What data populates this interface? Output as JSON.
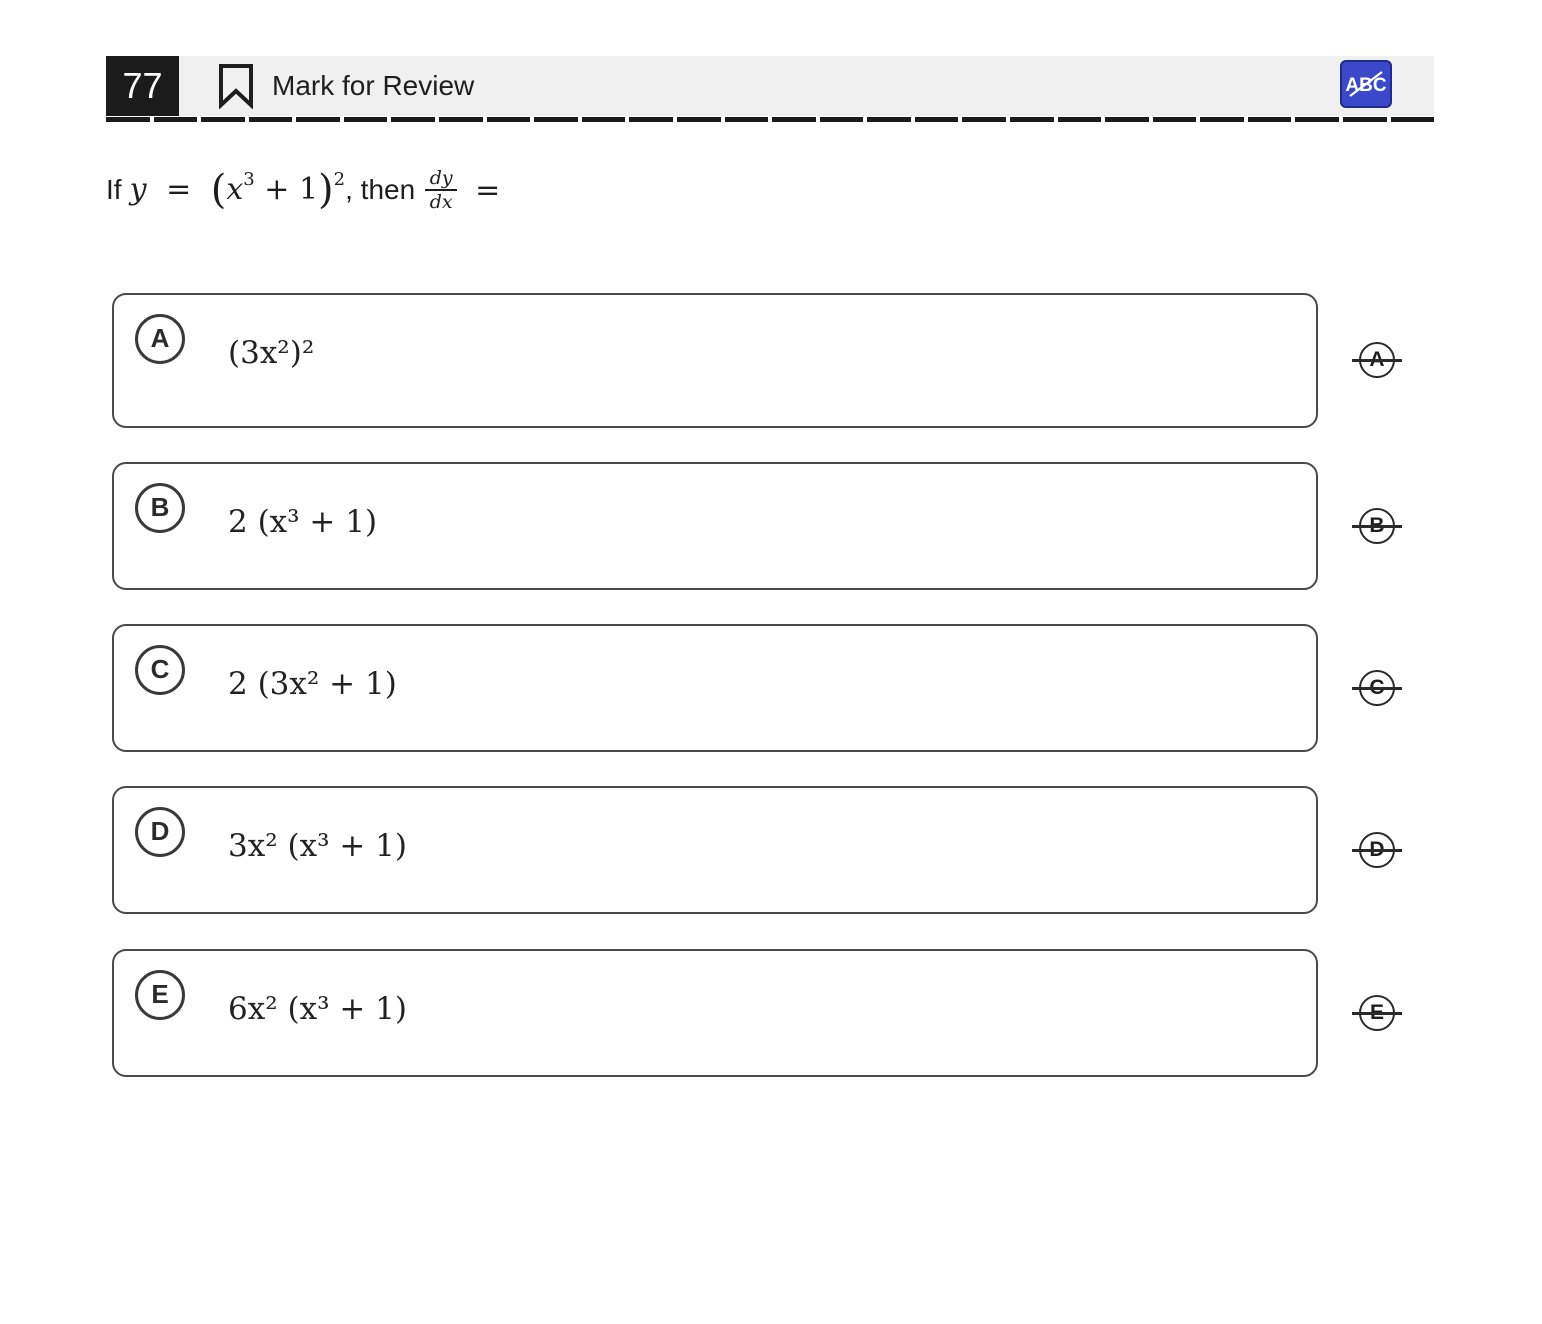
{
  "header": {
    "question_number": "77",
    "mark_for_review_label": "Mark for Review",
    "eliminator_tool_label": "ABC"
  },
  "question": {
    "prefix": "If",
    "variable": "y",
    "equals": "=",
    "base_var": "x",
    "base_exp": "3",
    "plus_one": "+ 1",
    "outer_exp": "2",
    "mid_text": ", then",
    "frac_num": "dy",
    "frac_den": "dx",
    "tail_equals": "="
  },
  "options": [
    {
      "letter": "A",
      "expr": "(3x²)²"
    },
    {
      "letter": "B",
      "expr": "2 (x³ + 1)"
    },
    {
      "letter": "C",
      "expr": "2 (3x² + 1)"
    },
    {
      "letter": "D",
      "expr": "3x² (x³ + 1)"
    },
    {
      "letter": "E",
      "expr": "6x² (x³ + 1)"
    }
  ],
  "colors": {
    "accent": "#3b48c9",
    "dark": "#1b1b1b",
    "header_bg": "#f0f0f0"
  }
}
